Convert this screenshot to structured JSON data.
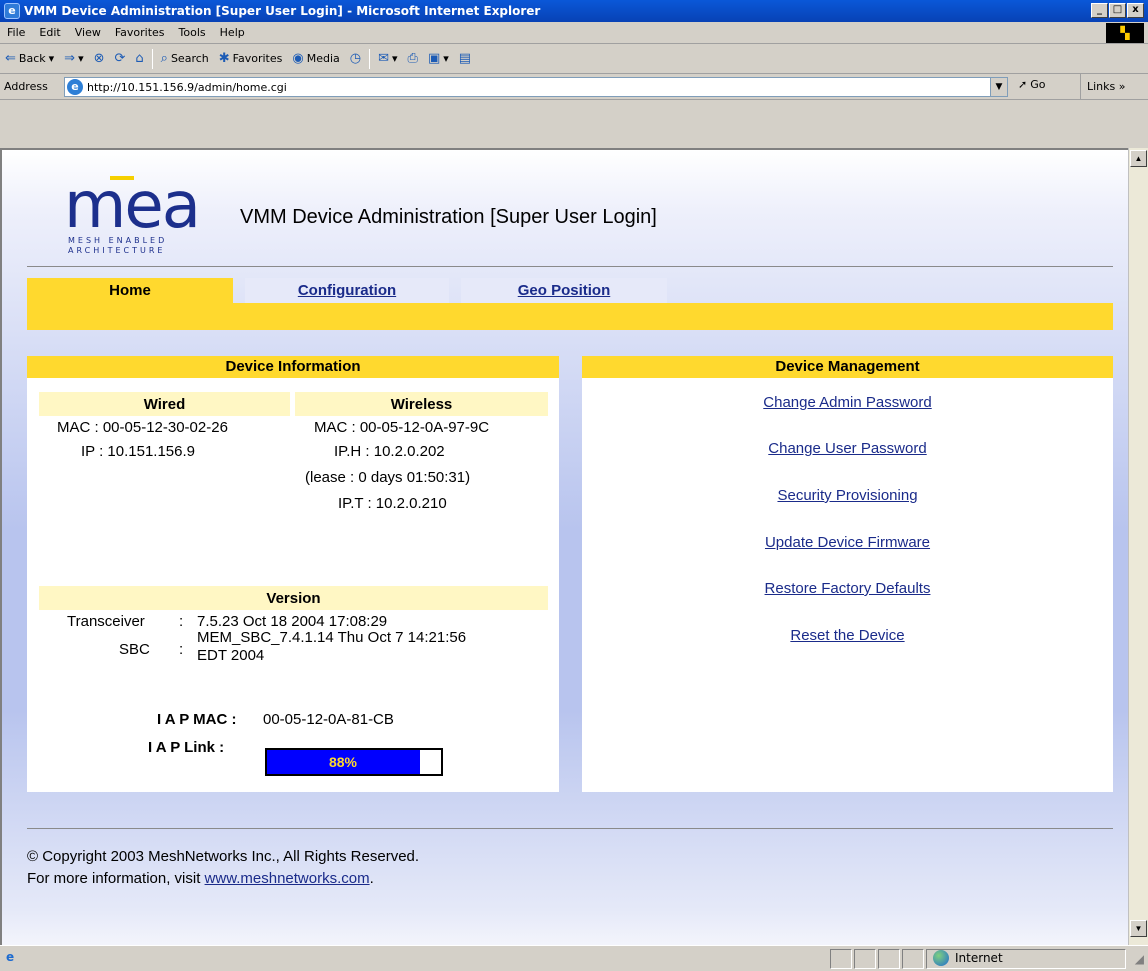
{
  "window": {
    "title": "VMM Device Administration [Super User Login] - Microsoft Internet Explorer",
    "minimize": "_",
    "maximize": "□",
    "close": "x"
  },
  "menu": [
    "File",
    "Edit",
    "View",
    "Favorites",
    "Tools",
    "Help"
  ],
  "toolbar": {
    "back": "Back",
    "search": "Search",
    "favorites": "Favorites",
    "media": "Media"
  },
  "address": {
    "label": "Address",
    "url": "http://10.151.156.9/admin/home.cgi",
    "go": "Go",
    "links": "Links"
  },
  "status": {
    "zone": "Internet"
  },
  "logo": {
    "word": "mea",
    "line1": "MESH ENABLED",
    "line2": "ARCHITECTURE"
  },
  "page": {
    "title": "VMM Device Administration [Super User Login]",
    "tabs": [
      {
        "label": "Home",
        "active": true
      },
      {
        "label": "Configuration",
        "active": false
      },
      {
        "label": "Geo Position",
        "active": false
      }
    ]
  },
  "device_info": {
    "title": "Device Information",
    "wired": {
      "heading": "Wired",
      "mac": "MAC : 00-05-12-30-02-26",
      "ip": "IP : 10.151.156.9"
    },
    "wireless": {
      "heading": "Wireless",
      "mac": "MAC : 00-05-12-0A-97-9C",
      "iph": "IP.H : 10.2.0.202",
      "lease": "(lease : 0 days 01:50:31)",
      "ipt": "IP.T : 10.2.0.210"
    },
    "version": {
      "heading": "Version",
      "transceiver_label": "Transceiver",
      "transceiver_value": "7.5.23 Oct 18 2004 17:08:29",
      "sbc_label": "SBC",
      "sbc_value_line1": "MEM_SBC_7.4.1.14 Thu Oct 7 14:21:56",
      "sbc_value_line2": "EDT 2004",
      "separator": ":"
    },
    "iap_mac_label": "I A P MAC :",
    "iap_mac_value": "00-05-12-0A-81-CB",
    "iap_link_label": "I A P Link :",
    "iap_link_text": "88%",
    "iap_link_percent": 88
  },
  "device_mgmt": {
    "title": "Device Management",
    "links": [
      "Change Admin Password",
      "Change User Password",
      "Security Provisioning",
      "Update Device Firmware",
      "Restore Factory Defaults",
      "Reset the Device"
    ]
  },
  "footer": {
    "copyright": "© Copyright 2003 MeshNetworks Inc., All Rights Reserved.",
    "more_prefix": "For more information, visit ",
    "more_link": "www.meshnetworks.com",
    "more_suffix": "."
  }
}
